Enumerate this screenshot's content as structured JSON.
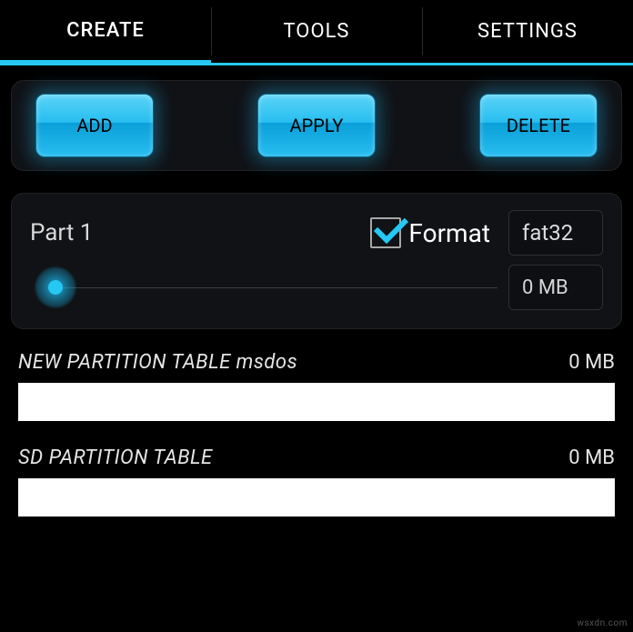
{
  "tabs": {
    "create": "CREATE",
    "tools": "TOOLS",
    "settings": "SETTINGS",
    "active": "create"
  },
  "actions": {
    "add": "ADD",
    "apply": "APPLY",
    "delete": "DELETE"
  },
  "partition": {
    "title": "Part 1",
    "format_label": "Format",
    "format_checked": true,
    "filesystem": "fat32",
    "size_label": "0 MB",
    "slider_value": 0
  },
  "tables": {
    "new": {
      "label": "NEW PARTITION TABLE",
      "type": "msdos",
      "size": "0 MB"
    },
    "sd": {
      "label": "SD PARTITION TABLE",
      "type": "",
      "size": "0 MB"
    }
  },
  "watermark": "wsxdn.com"
}
